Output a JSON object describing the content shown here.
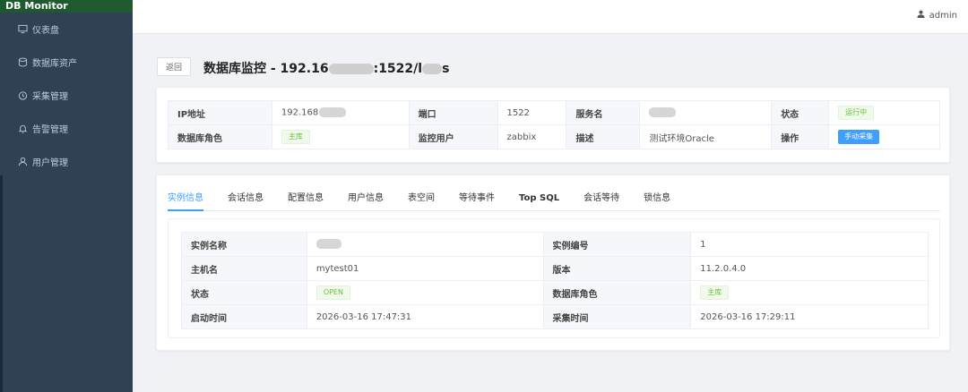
{
  "app": {
    "title": "DB Monitor"
  },
  "sidebar": {
    "items": [
      {
        "label": "仪表盘",
        "icon": "monitor-icon"
      },
      {
        "label": "数据库资产",
        "icon": "database-icon"
      },
      {
        "label": "采集管理",
        "icon": "clock-icon"
      },
      {
        "label": "告警管理",
        "icon": "bell-icon"
      },
      {
        "label": "用户管理",
        "icon": "user-icon"
      }
    ]
  },
  "header": {
    "user": "admin"
  },
  "page": {
    "back_label": "返回",
    "title_prefix": "数据库监控 - 192.16",
    "title_mid": ":1522/l",
    "title_suffix": "s"
  },
  "summary": {
    "ip_label": "IP地址",
    "ip_value": "192.168",
    "port_label": "端口",
    "port_value": "1522",
    "service_label": "服务名",
    "status_label": "状态",
    "status_value": "运行中",
    "role_label": "数据库角色",
    "role_value": "主库",
    "monitor_user_label": "监控用户",
    "monitor_user_value": "zabbix",
    "desc_label": "描述",
    "desc_value": "测试环境Oracle",
    "action_label": "操作",
    "action_button": "手动采集"
  },
  "tabs": [
    {
      "label": "实例信息",
      "active": true
    },
    {
      "label": "会话信息"
    },
    {
      "label": "配置信息"
    },
    {
      "label": "用户信息"
    },
    {
      "label": "表空间"
    },
    {
      "label": "等待事件"
    },
    {
      "label": "Top SQL"
    },
    {
      "label": "会话等待"
    },
    {
      "label": "锁信息"
    }
  ],
  "instance": {
    "name_label": "实例名称",
    "number_label": "实例编号",
    "number_value": "1",
    "host_label": "主机名",
    "host_value": "mytest01",
    "version_label": "版本",
    "version_value": "11.2.0.4.0",
    "status_label": "状态",
    "status_value": "OPEN",
    "role_label": "数据库角色",
    "role_value": "主库",
    "start_label": "启动时间",
    "start_value": "2026-03-16 17:47:31",
    "collect_label": "采集时间",
    "collect_value": "2026-03-16 17:29:11"
  },
  "colors": {
    "sidebar": "#304156",
    "brand": "#1f5a2e",
    "accent": "#409eff",
    "success": "#67c23a"
  }
}
